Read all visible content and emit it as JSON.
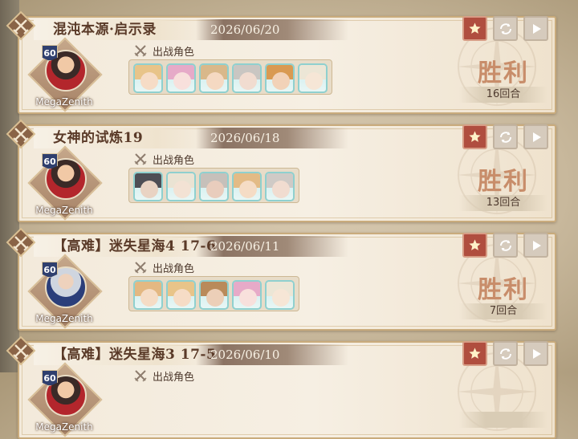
{
  "records": [
    {
      "title": "混沌本源·启示录",
      "date": "2026/06/20",
      "player": {
        "name": "MegaZenith",
        "level": "60"
      },
      "team_label": "出战角色",
      "characters": [
        {
          "hair": "#e8c489",
          "face": "#f6dcc6",
          "border": "#8fd0cf"
        },
        {
          "hair": "#e6aac8",
          "face": "#f8e0dc",
          "border": "#8fd0cf"
        },
        {
          "hair": "#d9b88a",
          "face": "#f5d9c2",
          "border": "#8fd0cf"
        },
        {
          "hair": "#c9c6c2",
          "face": "#f1dcd0",
          "border": "#8fd0cf"
        },
        {
          "hair": "#d99a52",
          "face": "#f2d2b8",
          "border": "#8fd0cf"
        },
        {
          "hair": "#ece6d6",
          "face": "#f6e6d6",
          "border": "#8fd0cf"
        }
      ],
      "result": "胜利",
      "rounds": "16回合"
    },
    {
      "title": "女神的试炼19",
      "date": "2026/06/18",
      "player": {
        "name": "MegaZenith",
        "level": "60"
      },
      "team_label": "出战角色",
      "characters": [
        {
          "hair": "#4e4e55",
          "face": "#e9d3c3",
          "border": "#8fd0cf"
        },
        {
          "hair": "#eae3d3",
          "face": "#f3e2d4",
          "border": "#8fd0cf"
        },
        {
          "hair": "#c6c0ba",
          "face": "#e9cdbd",
          "border": "#8fd0cf"
        },
        {
          "hair": "#e3bb86",
          "face": "#f5dcc5",
          "border": "#8fd0cf"
        },
        {
          "hair": "#cfcac6",
          "face": "#f1dcd0",
          "border": "#8fd0cf"
        }
      ],
      "result": "胜利",
      "rounds": "13回合"
    },
    {
      "title": "【高难】迷失星海4 17-6",
      "date": "2026/06/11",
      "player": {
        "name": "MegaZenith",
        "level": "60"
      },
      "team_label": "出战角色",
      "characters": [
        {
          "hair": "#e3b882",
          "face": "#f5dcc5",
          "border": "#8fd0cf"
        },
        {
          "hair": "#e8c489",
          "face": "#f6dcc6",
          "border": "#8fd0cf"
        },
        {
          "hair": "#b98a5a",
          "face": "#eccfb8",
          "border": "#8fd0cf"
        },
        {
          "hair": "#e6aac8",
          "face": "#f8e0dc",
          "border": "#8fd0cf"
        },
        {
          "hair": "#ece6d6",
          "face": "#f6e6d6",
          "border": "#8fd0cf"
        }
      ],
      "result": "胜利",
      "rounds": "7回合"
    },
    {
      "title": "【高难】迷失星海3 17-5",
      "date": "2026/06/10",
      "player": {
        "name": "MegaZenith",
        "level": "60"
      },
      "team_label": "出战角色",
      "characters": [],
      "result": "",
      "rounds": ""
    }
  ],
  "icons": {
    "favorite": "star-icon",
    "share": "share-refresh-icon",
    "replay": "play-icon",
    "team": "crossed-swords-icon",
    "crest": "crossed-swords-crest-icon"
  },
  "colors": {
    "accent_red": "#b04e3f",
    "victory_text": "#c88d6a",
    "date_bar": "#8b7363",
    "card_border": "#c9ab7c"
  }
}
